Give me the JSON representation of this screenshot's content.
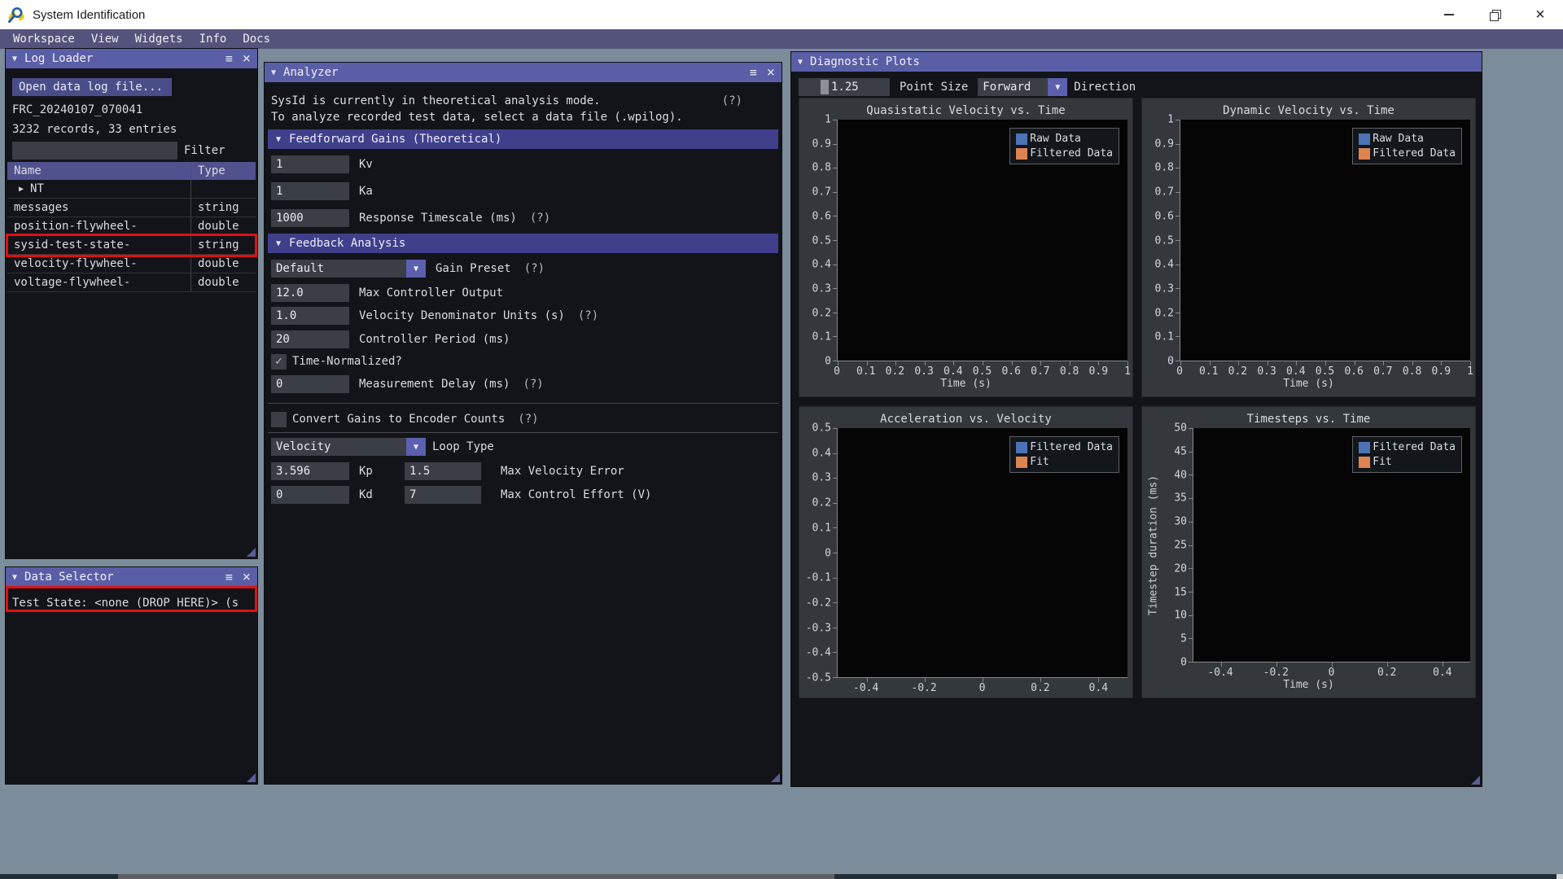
{
  "titlebar": {
    "title": "System Identification"
  },
  "menubar": {
    "items": [
      "Workspace",
      "View",
      "Widgets",
      "Info",
      "Docs"
    ]
  },
  "log_loader": {
    "title": "Log Loader",
    "open_button": "Open data log file...",
    "file_name": "FRC_20240107_070041",
    "records_info": "3232 records, 33 entries",
    "filter_label": "Filter",
    "filter_value": "",
    "table": {
      "col_name": "Name",
      "col_type": "Type",
      "rows": [
        {
          "name": "NT",
          "type": ""
        },
        {
          "name": "messages",
          "type": "string"
        },
        {
          "name": "position-flywheel-",
          "type": "double"
        },
        {
          "name": "sysid-test-state-",
          "type": "string"
        },
        {
          "name": "velocity-flywheel-",
          "type": "double"
        },
        {
          "name": "voltage-flywheel-",
          "type": "double"
        }
      ]
    }
  },
  "data_selector": {
    "title": "Data Selector",
    "test_state": "Test State: <none (DROP HERE)> (s"
  },
  "analyzer": {
    "title": "Analyzer",
    "mode_line1": "SysId is currently in theoretical analysis mode.",
    "mode_line2": "To analyze recorded test data, select a data file (.wpilog).",
    "help": "(?)",
    "feedforward_header": "Feedforward Gains (Theoretical)",
    "kv": {
      "value": "1",
      "label": "Kv"
    },
    "ka": {
      "value": "1",
      "label": "Ka"
    },
    "response_timescale": {
      "value": "1000",
      "label": "Response Timescale (ms)"
    },
    "feedback_header": "Feedback Analysis",
    "gain_preset": {
      "value": "Default",
      "label": "Gain Preset"
    },
    "max_controller_output": {
      "value": "12.0",
      "label": "Max Controller Output"
    },
    "velocity_denominator": {
      "value": "1.0",
      "label": "Velocity Denominator Units (s)"
    },
    "controller_period": {
      "value": "20",
      "label": "Controller Period (ms)"
    },
    "time_normalized": {
      "label": "Time-Normalized?",
      "checked": true
    },
    "measurement_delay": {
      "value": "0",
      "label": "Measurement Delay (ms)"
    },
    "convert_gains": {
      "label": "Convert Gains to Encoder Counts",
      "checked": false
    },
    "loop_type": {
      "value": "Velocity",
      "label": "Loop Type"
    },
    "kp": {
      "value": "3.596",
      "label": "Kp"
    },
    "max_velocity_error": {
      "value": "1.5",
      "label": "Max Velocity Error"
    },
    "kd": {
      "value": "0",
      "label": "Kd"
    },
    "max_control_effort": {
      "value": "7",
      "label": "Max Control Effort (V)"
    }
  },
  "diagnostic_plots": {
    "title": "Diagnostic Plots",
    "point_size": {
      "value": "1.25",
      "label": "Point Size"
    },
    "direction": {
      "value": "Forward",
      "label": "Direction"
    },
    "plots": [
      {
        "title": "Quasistatic Velocity vs. Time",
        "y_ticks": [
          "1",
          "0.9",
          "0.8",
          "0.7",
          "0.6",
          "0.5",
          "0.4",
          "0.3",
          "0.2",
          "0.1",
          "0"
        ],
        "x_ticks": [
          "0",
          "0.1",
          "0.2",
          "0.3",
          "0.4",
          "0.5",
          "0.6",
          "0.7",
          "0.8",
          "0.9",
          "1"
        ],
        "x_inset": 0,
        "xlabel": "Time (s)",
        "ylabel": "",
        "legend": [
          {
            "label": "Raw Data",
            "color": "#4C72B8"
          },
          {
            "label": "Filtered Data",
            "color": "#DD8452"
          }
        ]
      },
      {
        "title": "Dynamic Velocity vs. Time",
        "y_ticks": [
          "1",
          "0.9",
          "0.8",
          "0.7",
          "0.6",
          "0.5",
          "0.4",
          "0.3",
          "0.2",
          "0.1",
          "0"
        ],
        "x_ticks": [
          "0",
          "0.1",
          "0.2",
          "0.3",
          "0.4",
          "0.5",
          "0.6",
          "0.7",
          "0.8",
          "0.9",
          "1"
        ],
        "x_inset": 0,
        "xlabel": "Time (s)",
        "ylabel": "",
        "legend": [
          {
            "label": "Raw Data",
            "color": "#4C72B8"
          },
          {
            "label": "Filtered Data",
            "color": "#DD8452"
          }
        ]
      },
      {
        "title": "Acceleration vs. Velocity",
        "y_ticks": [
          "0.5",
          "0.4",
          "0.3",
          "0.2",
          "0.1",
          "0",
          "-0.1",
          "-0.2",
          "-0.3",
          "-0.4",
          "-0.5"
        ],
        "x_ticks": [
          "-0.4",
          "-0.2",
          "0",
          "0.2",
          "0.4"
        ],
        "x_inset": 0.1,
        "xlabel": "",
        "ylabel": "",
        "legend": [
          {
            "label": "Filtered Data",
            "color": "#4C72B8"
          },
          {
            "label": "Fit",
            "color": "#DD8452"
          }
        ]
      },
      {
        "title": "Timesteps vs. Time",
        "y_ticks": [
          "50",
          "45",
          "40",
          "35",
          "30",
          "25",
          "20",
          "15",
          "10",
          "5",
          "0"
        ],
        "x_ticks": [
          "-0.4",
          "-0.2",
          "0",
          "0.2",
          "0.4"
        ],
        "x_inset": 0.1,
        "xlabel": "Time (s)",
        "ylabel": "Timestep duration (ms)",
        "legend": [
          {
            "label": "Filtered Data",
            "color": "#4C72B8"
          },
          {
            "label": "Fit",
            "color": "#DD8452"
          }
        ]
      }
    ]
  },
  "chart_data": [
    {
      "type": "scatter",
      "title": "Quasistatic Velocity vs. Time",
      "xlabel": "Time (s)",
      "ylabel": "",
      "xlim": [
        0,
        1
      ],
      "ylim": [
        0,
        1
      ],
      "legend": [
        "Raw Data",
        "Filtered Data"
      ],
      "legend_position": "top-right",
      "grid": false,
      "series": []
    },
    {
      "type": "scatter",
      "title": "Dynamic Velocity vs. Time",
      "xlabel": "Time (s)",
      "ylabel": "",
      "xlim": [
        0,
        1
      ],
      "ylim": [
        0,
        1
      ],
      "legend": [
        "Raw Data",
        "Filtered Data"
      ],
      "legend_position": "top-right",
      "grid": false,
      "series": []
    },
    {
      "type": "scatter",
      "title": "Acceleration vs. Velocity",
      "xlabel": "",
      "ylabel": "",
      "xlim": [
        -0.5,
        0.5
      ],
      "ylim": [
        -0.5,
        0.5
      ],
      "legend": [
        "Filtered Data",
        "Fit"
      ],
      "legend_position": "top-right",
      "grid": false,
      "series": []
    },
    {
      "type": "scatter",
      "title": "Timesteps vs. Time",
      "xlabel": "Time (s)",
      "ylabel": "Timestep duration (ms)",
      "xlim": [
        -0.5,
        0.5
      ],
      "ylim": [
        0,
        50
      ],
      "legend": [
        "Filtered Data",
        "Fit"
      ],
      "legend_position": "top-right",
      "grid": false,
      "series": []
    }
  ]
}
